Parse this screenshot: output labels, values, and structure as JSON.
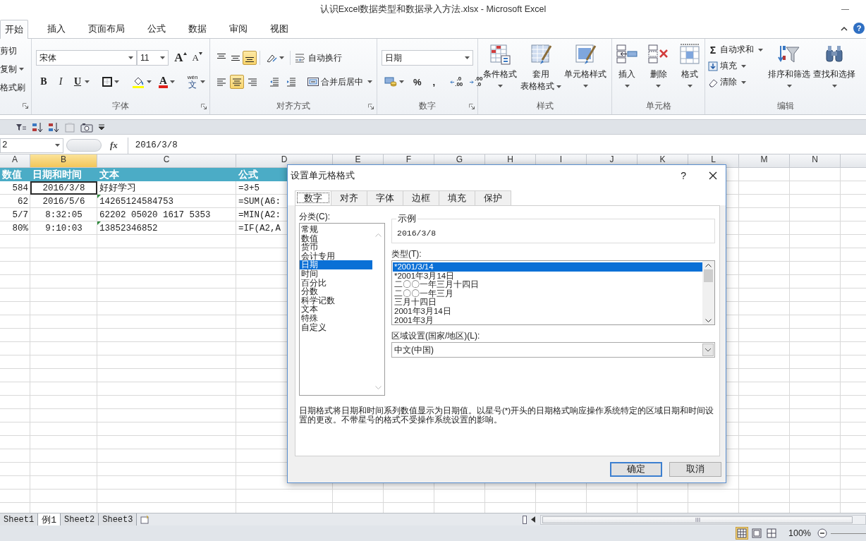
{
  "window": {
    "title": "认识Excel数据类型和数据录入方法.xlsx - Microsoft Excel"
  },
  "ribbon_tabs": [
    {
      "label": "开始",
      "selected": true
    },
    {
      "label": "插入",
      "selected": false
    },
    {
      "label": "页面布局",
      "selected": false
    },
    {
      "label": "公式",
      "selected": false
    },
    {
      "label": "数据",
      "selected": false
    },
    {
      "label": "审阅",
      "selected": false
    },
    {
      "label": "视图",
      "selected": false
    }
  ],
  "ribbon_help": "?",
  "ribbon": {
    "clipboard": {
      "launcher": true,
      "items": [
        {
          "label": "剪切",
          "dropdown": false
        },
        {
          "label": "复制",
          "dropdown": true
        },
        {
          "label": "格式刷",
          "dropdown": false
        }
      ]
    },
    "font": {
      "label": "字体",
      "launcher": true,
      "font_name": "宋体",
      "font_size": "11",
      "grow": "A",
      "shrink": "A",
      "styles": [
        {
          "kind": "bold",
          "text": "B"
        },
        {
          "kind": "italic",
          "text": "I"
        },
        {
          "kind": "underline",
          "text": "U"
        }
      ],
      "font_color": "A",
      "phonetic": {
        "ruby": "wén",
        "text": "文"
      }
    },
    "alignment": {
      "label": "对齐方式",
      "launcher": true,
      "vertical": [
        {
          "kind": "top",
          "on": false
        },
        {
          "kind": "middle",
          "on": false
        },
        {
          "kind": "bottom",
          "on": true
        }
      ],
      "horizontal": [
        {
          "kind": "left",
          "on": false
        },
        {
          "kind": "center",
          "on": true
        },
        {
          "kind": "right",
          "on": false
        }
      ],
      "wrap_text": "自动换行",
      "merge_center": "合并后居中"
    },
    "number": {
      "label": "数字",
      "launcher": true,
      "format": "日期",
      "percent": "%",
      "comma": ",",
      "decimals": [
        {
          "kind": "increase",
          "lines": [
            ".0",
            ".00"
          ]
        },
        {
          "kind": "decrease",
          "lines": [
            ".00",
            ".0"
          ]
        }
      ]
    },
    "styles": {
      "label": "样式",
      "buttons": [
        {
          "kind": "conditional",
          "lines": [
            "条件格式"
          ]
        },
        {
          "kind": "table",
          "lines": [
            "套用",
            "表格格式"
          ]
        },
        {
          "kind": "cell_styles",
          "lines": [
            "单元格样式"
          ]
        }
      ]
    },
    "cells": {
      "label": "单元格",
      "buttons": [
        {
          "kind": "insert",
          "lines": [
            "插入"
          ]
        },
        {
          "kind": "delete",
          "lines": [
            "删除"
          ]
        },
        {
          "kind": "format",
          "lines": [
            "格式"
          ]
        }
      ]
    },
    "editing": {
      "label": "编辑",
      "small": [
        {
          "kind": "autosum",
          "glyph": "Σ",
          "label": "自动求和"
        },
        {
          "kind": "fill",
          "label": "填充"
        },
        {
          "kind": "clear",
          "label": "清除"
        }
      ],
      "buttons": [
        {
          "kind": "sort",
          "lines": [
            "排序和筛选"
          ]
        },
        {
          "kind": "find",
          "lines": [
            "查找和选择"
          ]
        }
      ]
    }
  },
  "quick_access": [
    {
      "kind": "filter"
    },
    {
      "kind": "sort_asc"
    },
    {
      "kind": "sort_desc"
    },
    {
      "kind": "numbers"
    },
    {
      "kind": "camera"
    },
    {
      "kind": "customize"
    }
  ],
  "formula_bar": {
    "name_box": "2",
    "fx": "fx",
    "value": "2016/3/8"
  },
  "sheet": {
    "columns": [
      {
        "letter": "A",
        "selected": false
      },
      {
        "letter": "B",
        "selected": true
      },
      {
        "letter": "C",
        "selected": false
      },
      {
        "letter": "D",
        "selected": false
      },
      {
        "letter": "E",
        "selected": false
      },
      {
        "letter": "F",
        "selected": false
      },
      {
        "letter": "G",
        "selected": false
      },
      {
        "letter": "H",
        "selected": false
      },
      {
        "letter": "I",
        "selected": false
      },
      {
        "letter": "J",
        "selected": false
      },
      {
        "letter": "K",
        "selected": false
      },
      {
        "letter": "L",
        "selected": false
      },
      {
        "letter": "M",
        "selected": false
      },
      {
        "letter": "N",
        "selected": false
      }
    ],
    "rows": [
      {
        "kind": "header",
        "cells": [
          {
            "text": "数值"
          },
          {
            "text": "日期和时间"
          },
          {
            "text": "文本"
          },
          {
            "text": "公式"
          }
        ]
      },
      {
        "kind": "data",
        "cells": [
          {
            "text": "584",
            "selected": false,
            "error_flag": false
          },
          {
            "text": "2016/3/8",
            "selected": true,
            "error_flag": false
          },
          {
            "text": "好好学习",
            "selected": false,
            "error_flag": false
          },
          {
            "text": "=3+5",
            "selected": false,
            "error_flag": false
          }
        ]
      },
      {
        "kind": "data",
        "cells": [
          {
            "text": "62",
            "selected": false,
            "error_flag": false
          },
          {
            "text": "2016/5/6",
            "selected": false,
            "error_flag": false
          },
          {
            "text": "14265124584753",
            "selected": false,
            "error_flag": true
          },
          {
            "text": "=SUM(A6:",
            "selected": false,
            "error_flag": false
          }
        ]
      },
      {
        "kind": "data",
        "cells": [
          {
            "text": "5/7",
            "selected": false,
            "error_flag": false
          },
          {
            "text": "8:32:05",
            "selected": false,
            "error_flag": false
          },
          {
            "text": "62202 05020 1617 5353",
            "selected": false,
            "error_flag": false
          },
          {
            "text": "=MIN(A2:",
            "selected": false,
            "error_flag": false
          }
        ]
      },
      {
        "kind": "data",
        "cells": [
          {
            "text": "80%",
            "selected": false,
            "error_flag": false
          },
          {
            "text": "9:10:03",
            "selected": false,
            "error_flag": false
          },
          {
            "text": "13852346852",
            "selected": false,
            "error_flag": true
          },
          {
            "text": "=IF(A2,A",
            "selected": false,
            "error_flag": false
          }
        ]
      }
    ]
  },
  "sheet_tabs": [
    {
      "label": "Sheet1",
      "selected": false
    },
    {
      "label": "例1",
      "selected": true
    },
    {
      "label": "Sheet2",
      "selected": false
    },
    {
      "label": "Sheet3",
      "selected": false
    }
  ],
  "status_bar": {
    "views": [
      {
        "kind": "normal",
        "selected": true
      },
      {
        "kind": "page_layout",
        "selected": false
      },
      {
        "kind": "page_break",
        "selected": false
      }
    ],
    "zoom": "100%"
  },
  "dialog": {
    "title": "设置单元格格式",
    "help": "?",
    "tabs": [
      {
        "label": "数字",
        "selected": true
      },
      {
        "label": "对齐",
        "selected": false
      },
      {
        "label": "字体",
        "selected": false
      },
      {
        "label": "边框",
        "selected": false
      },
      {
        "label": "填充",
        "selected": false
      },
      {
        "label": "保护",
        "selected": false
      }
    ],
    "category_label": "分类(C):",
    "categories": [
      {
        "label": "常规",
        "selected": false
      },
      {
        "label": "数值",
        "selected": false
      },
      {
        "label": "货币",
        "selected": false
      },
      {
        "label": "会计专用",
        "selected": false
      },
      {
        "label": "日期",
        "selected": true
      },
      {
        "label": "时间",
        "selected": false
      },
      {
        "label": "百分比",
        "selected": false
      },
      {
        "label": "分数",
        "selected": false
      },
      {
        "label": "科学记数",
        "selected": false
      },
      {
        "label": "文本",
        "selected": false
      },
      {
        "label": "特殊",
        "selected": false
      },
      {
        "label": "自定义",
        "selected": false
      }
    ],
    "sample_label": "示例",
    "sample": "2016/3/8",
    "type_label": "类型(T):",
    "types": [
      {
        "label": "*2001/3/14",
        "selected": true
      },
      {
        "label": "*2001年3月14日",
        "selected": false
      },
      {
        "label": "二〇〇一年三月十四日",
        "selected": false
      },
      {
        "label": "二〇〇一年三月",
        "selected": false
      },
      {
        "label": "三月十四日",
        "selected": false
      },
      {
        "label": "2001年3月14日",
        "selected": false
      },
      {
        "label": "2001年3月",
        "selected": false
      }
    ],
    "locale_label": "区域设置(国家/地区)(L):",
    "locale": "中文(中国)",
    "description": "日期格式将日期和时间系列数值显示为日期值。以星号(*)开头的日期格式响应操作系统特定的区域日期和时间设置的更改。不带星号的格式不受操作系统设置的影响。",
    "buttons": [
      {
        "label": "确定",
        "default": true
      },
      {
        "label": "取消",
        "default": false
      }
    ]
  }
}
